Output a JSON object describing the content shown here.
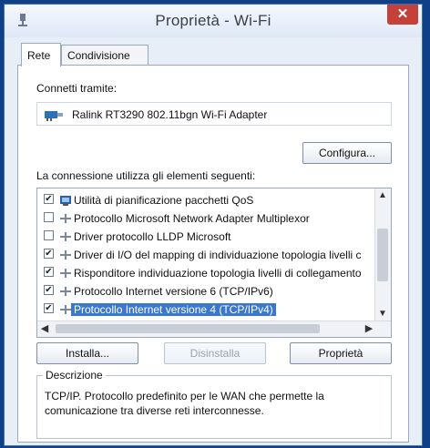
{
  "window": {
    "title": "Proprietà - Wi-Fi",
    "close_label": "✕"
  },
  "tabs": [
    {
      "label": "Rete"
    },
    {
      "label": "Condivisione"
    }
  ],
  "connect_via_label": "Connetti tramite:",
  "adapter_name": "Ralink RT3290 802.11bgn Wi-Fi Adapter",
  "configure_button": "Configura...",
  "items_label": "La connessione utilizza gli elementi seguenti:",
  "items": [
    {
      "label": "Utilità di pianificazione pacchetti QoS",
      "checked": true,
      "icon": "qos-icon"
    },
    {
      "label": "Protocollo Microsoft Network Adapter Multiplexor",
      "checked": false,
      "icon": "protocol-icon"
    },
    {
      "label": "Driver protocollo LLDP Microsoft",
      "checked": false,
      "icon": "protocol-icon"
    },
    {
      "label": "Driver di I/O del mapping di individuazione topologia livelli c",
      "checked": true,
      "icon": "protocol-icon"
    },
    {
      "label": "Risponditore individuazione topologia livelli di collegamento",
      "checked": true,
      "icon": "protocol-icon"
    },
    {
      "label": "Protocollo Internet versione 6 (TCP/IPv6)",
      "checked": true,
      "icon": "protocol-icon"
    },
    {
      "label": "Protocollo Internet versione 4 (TCP/IPv4)",
      "checked": true,
      "icon": "protocol-icon",
      "selected": true
    }
  ],
  "buttons": {
    "install": "Installa...",
    "uninstall": "Disinstalla",
    "properties": "Proprietà"
  },
  "description": {
    "title": "Descrizione",
    "text": "TCP/IP. Protocollo predefinito per le WAN che permette la comunicazione tra diverse reti interconnesse."
  },
  "colors": {
    "selection": "#3a78d0",
    "close": "#c6403a"
  }
}
